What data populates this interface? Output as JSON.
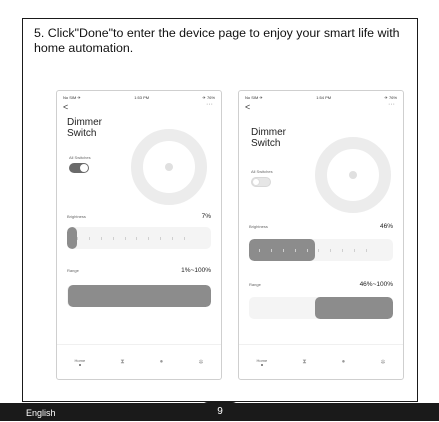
{
  "instruction": "5. Click\"Done\"to enter the device page to enjoy your smart life with home automation.",
  "footer": {
    "language": "English",
    "page_number": "9"
  },
  "phones": [
    {
      "status_left": "No SIM ✈",
      "status_time": "1:53 PM",
      "status_right": "✈ 76%",
      "back": "<",
      "more": "···",
      "device_title": "Dimmer Switch",
      "all_switches": "All Switches",
      "toggle_on": true,
      "brightness_label": "Brightness",
      "brightness_value": "7%",
      "brightness_fill": 0.07,
      "range_label": "Range",
      "range_value": "1%~100%",
      "range_fill": [
        0.01,
        1.0
      ],
      "nav_home": "Home"
    },
    {
      "status_left": "No SIM ✈",
      "status_time": "1:54 PM",
      "status_right": "✈ 76%",
      "back": "<",
      "more": "···",
      "device_title": "Dimmer Switch",
      "all_switches": "All Switches",
      "toggle_on": false,
      "brightness_label": "Brightness",
      "brightness_value": "46%",
      "brightness_fill": 0.46,
      "range_label": "Range",
      "range_value": "46%~100%",
      "range_fill": [
        0.46,
        1.0
      ],
      "nav_home": "Home"
    }
  ],
  "colors": {
    "accent": "#6a6a6a",
    "fill": "#8c8c8c",
    "footer": "#1a1a1a"
  }
}
